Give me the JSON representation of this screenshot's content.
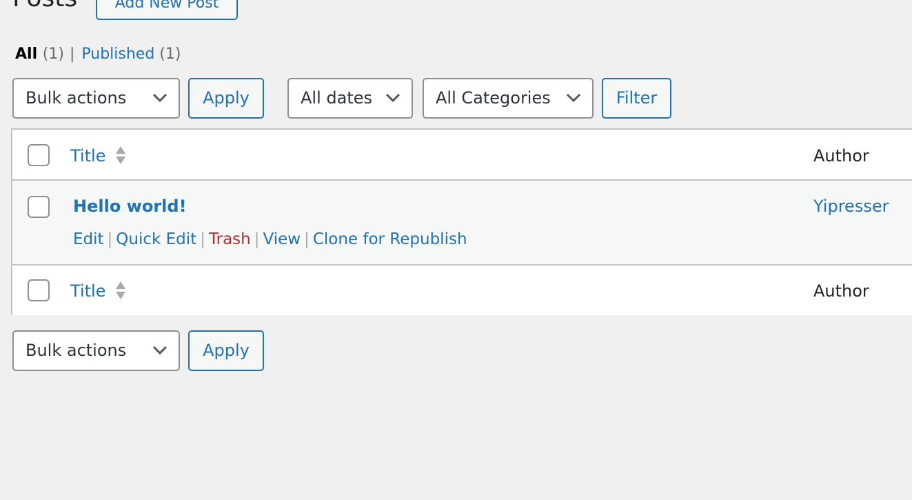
{
  "header": {
    "title": "Posts",
    "add_new_label": "Add New Post"
  },
  "views": {
    "all_label": "All",
    "all_count": "(1)",
    "separator": "|",
    "published_label": "Published",
    "published_count": "(1)"
  },
  "top_nav": {
    "bulk_actions": {
      "selected": "Bulk actions",
      "icon": "chevron-down-icon"
    },
    "apply_label": "Apply",
    "dates_filter": {
      "selected": "All dates",
      "icon": "chevron-down-icon"
    },
    "categories_filter": {
      "selected": "All Categories",
      "icon": "chevron-down-icon"
    },
    "filter_label": "Filter"
  },
  "table": {
    "columns": [
      {
        "label": "Title",
        "sortable": true,
        "sort_icon": "sort-arrows-icon"
      },
      {
        "label": "Author",
        "sortable": false
      }
    ],
    "rows": [
      {
        "title": "Hello world!",
        "author": "Yipresser",
        "actions": [
          {
            "label": "Edit"
          },
          {
            "label": "Quick Edit"
          },
          {
            "label": "Trash"
          },
          {
            "label": "View"
          },
          {
            "label": "Clone for Republish"
          }
        ],
        "action_separator": "|"
      }
    ]
  },
  "bottom_nav": {
    "bulk_actions": {
      "selected": "Bulk actions",
      "icon": "chevron-down-icon"
    },
    "apply_label": "Apply"
  },
  "colors": {
    "accent": "#2271b1",
    "danger": "#b32d2e",
    "background": "#f0f0f1",
    "border": "#c3c4c7"
  }
}
